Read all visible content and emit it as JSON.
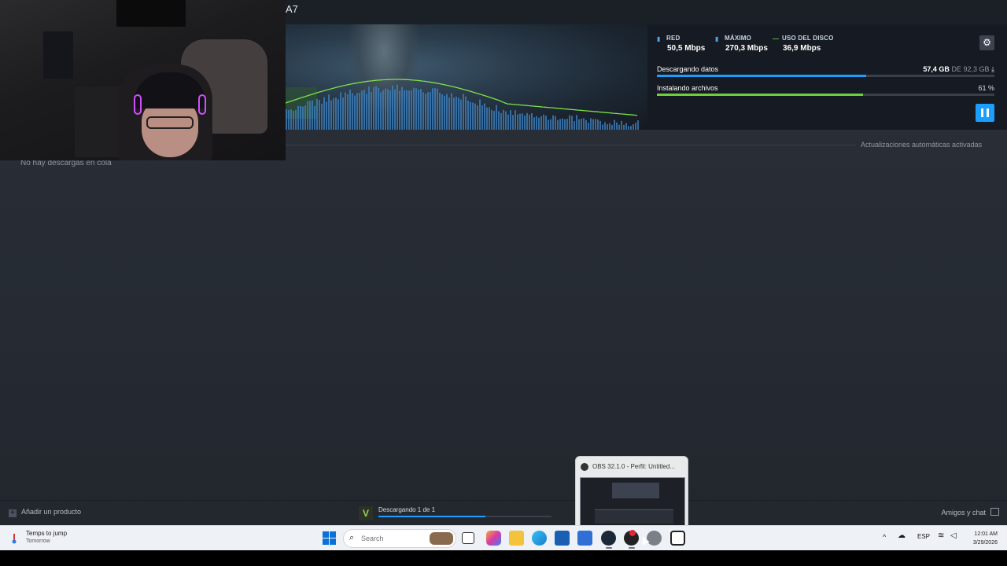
{
  "steam": {
    "game_title_fragment": "A7",
    "stats": {
      "network": {
        "label": "RED",
        "value": "50,5 Mbps",
        "color": "#4fa3e6"
      },
      "peak": {
        "label": "MÁXIMO",
        "value": "270,3 Mbps",
        "color": "#4fa3e6"
      },
      "disk": {
        "label": "USO DEL DISCO",
        "value": "36,9 Mbps",
        "color": "#6fcf3a"
      }
    },
    "downloading": {
      "label": "Descargando datos",
      "done": "57,4 GB",
      "of": "DE",
      "total": "92,3 GB",
      "progress": 0.62,
      "color": "#1a9fff"
    },
    "installing": {
      "label": "Instalando archivos",
      "percent_text": "61 %",
      "progress": 0.61,
      "color": "#6fcf3a"
    },
    "auto_updates": "Actualizaciones automáticas activadas",
    "queue_empty": "No hay descargas en cola",
    "footer": {
      "add_product": "Añadir un producto",
      "download_status": "Descargando 1 de 1",
      "download_progress": 0.62,
      "friends_chat": "Amigos y chat"
    }
  },
  "obs_preview": {
    "title": "OBS 32.1.0 - Perfil: Untitled..."
  },
  "taskbar": {
    "weather_title": "Temps to jump",
    "weather_sub": "Tomorrow",
    "search_placeholder": "Search",
    "language": "ESP",
    "time": "12:01 AM",
    "date": "3/29/2026",
    "apps": [
      "file-explorer-icon",
      "copilot-icon",
      "folder-icon",
      "edge-icon",
      "store-icon",
      "outlook-icon",
      "steam-icon",
      "obs-icon",
      "settings-icon",
      "camera-icon"
    ]
  }
}
